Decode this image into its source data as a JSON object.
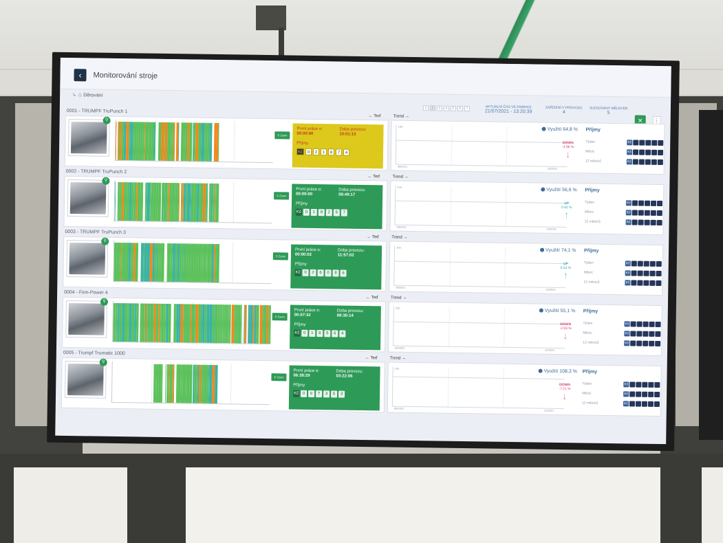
{
  "header": {
    "title": "Monitorování stroje",
    "back_label": "‹",
    "breadcrumb": "Děrování",
    "pager": [
      "1",
      "2",
      "3",
      "4",
      "5",
      "6",
      "7"
    ],
    "current_time_label": "AKTUÁLNÍ ČAS VE FABRICE",
    "current_time": "21/07/2021 - 13:20:39",
    "devices_label": "ZAŘÍZENÍ V PROVOZU",
    "devices_value": "4",
    "tracked_label": "SLEDOVANÝ MĚLNTER",
    "tracked_value": "5",
    "fullscreen_icon": "expand-icon",
    "menu_icon": "kebab-icon"
  },
  "labels": {
    "zoom": "Zoom",
    "prev": "← Teď",
    "next": "Trend →",
    "first_work": "První práce o:",
    "run_time": "Doba provozu:",
    "income": "Příjmy",
    "currency": "Kč",
    "utilization_prefix": "Využití",
    "income_title": "Příjmy",
    "week": "Týden",
    "month": "Měsíc",
    "twelve_months": "12 měsíců",
    "chart_y": "100",
    "chart_x_left": "09/2021",
    "chart_x_right": "10/2021"
  },
  "machines": [
    {
      "name": "0001 - TRUMPF TruPunch 1",
      "status": "yellow",
      "first_work": "00:00:00",
      "run_time": "10:01:13",
      "income_digits": [
        "0",
        "2",
        "1",
        "8",
        "7",
        "4"
      ],
      "utilization": "64,8 %",
      "trend": "down",
      "trend_label": "DOWN",
      "trend_pct": "-3.96 %"
    },
    {
      "name": "0002 - TRUMPF TruPunch 2",
      "status": "green",
      "first_work": "00:00:00",
      "run_time": "08:49:17",
      "income_digits": [
        "0",
        "1",
        "9",
        "2",
        "6",
        "7"
      ],
      "utilization": "56,6 %",
      "trend": "up",
      "trend_label": "UP",
      "trend_pct": "0.92 %"
    },
    {
      "name": "0003 - TRUMPF TruPunch 3",
      "status": "green",
      "first_work": "00:00:02",
      "run_time": "11:57:02",
      "income_digits": [
        "0",
        "2",
        "6",
        "0",
        "8",
        "6"
      ],
      "utilization": "74,1 %",
      "trend": "up",
      "trend_label": "UP",
      "trend_pct": "6.63 %"
    },
    {
      "name": "0004 - Finn-Power 4",
      "status": "green",
      "first_work": "00:57:32",
      "run_time": "08:30:14",
      "income_digits": [
        "0",
        "1",
        "8",
        "5",
        "6",
        "4"
      ],
      "utilization": "55,1 %",
      "trend": "down",
      "trend_label": "DOWN",
      "trend_pct": "-2.93 %"
    },
    {
      "name": "0005 - Trumpf Trumatic 1000",
      "status": "green",
      "first_work": "06:38:29",
      "run_time": "03:22:06",
      "income_digits": [
        "0",
        "0",
        "7",
        "3",
        "5",
        "3"
      ],
      "utilization": "108,3 %",
      "trend": "down",
      "trend_label": "DOWN",
      "trend_pct": "-7.21 %"
    }
  ],
  "colors": {
    "green_ok": "#5cc15c",
    "orange": "#ef8a1e",
    "teal": "#3bb3a6",
    "status_green": "#2e9a57",
    "status_yellow": "#ddc81c"
  }
}
